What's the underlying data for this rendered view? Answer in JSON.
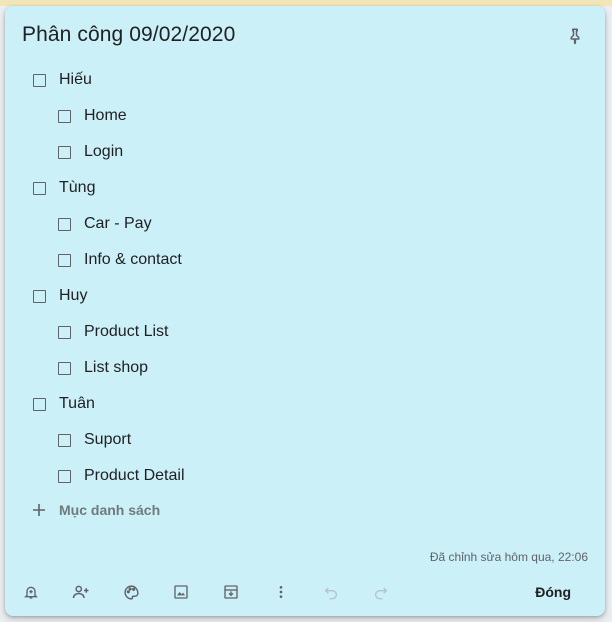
{
  "note": {
    "title": "Phân công 09/02/2020",
    "items": [
      {
        "label": "Hiếu",
        "level": 0
      },
      {
        "label": "Home",
        "level": 1
      },
      {
        "label": "Login",
        "level": 1
      },
      {
        "label": "Tùng",
        "level": 0
      },
      {
        "label": "Car - Pay",
        "level": 1
      },
      {
        "label": "Info & contact",
        "level": 1
      },
      {
        "label": "Huy",
        "level": 0
      },
      {
        "label": "Product List",
        "level": 1
      },
      {
        "label": "List shop",
        "level": 1
      },
      {
        "label": "Tuân",
        "level": 0
      },
      {
        "label": "Suport",
        "level": 1
      },
      {
        "label": "Product Detail",
        "level": 1
      }
    ],
    "add_item_placeholder": "Mục danh sách",
    "edited": "Đã chỉnh sửa hôm qua, 22:06",
    "colors": {
      "background": "#cbf0f8",
      "text": "#202124",
      "icon": "#5f6368"
    }
  },
  "toolbar": {
    "icons": [
      "bell-plus-icon",
      "add-collaborator-icon",
      "palette-icon",
      "image-icon",
      "archive-icon",
      "more-vert-icon",
      "undo-icon",
      "redo-icon"
    ],
    "close_label": "Đóng"
  }
}
